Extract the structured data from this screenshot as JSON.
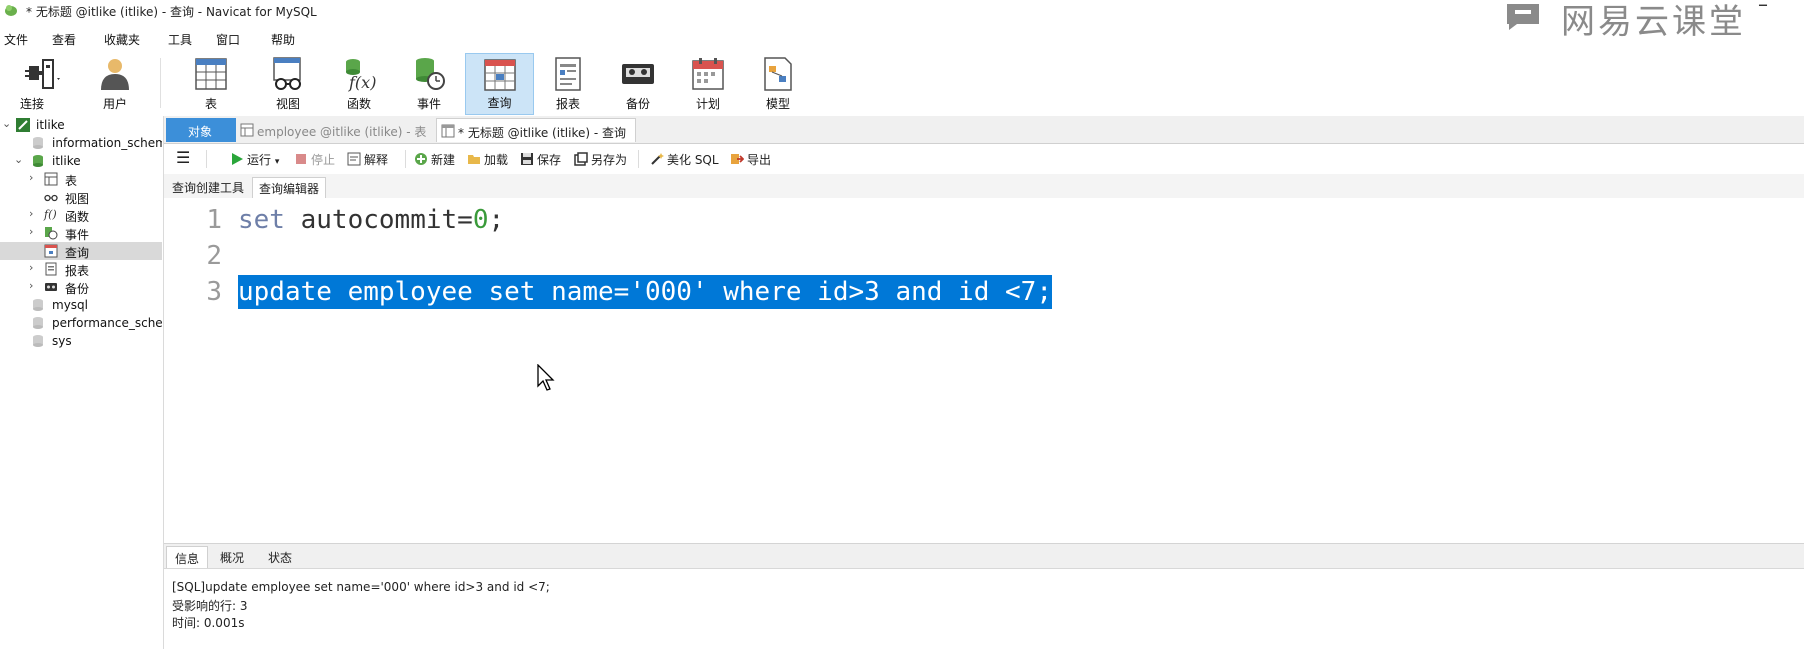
{
  "window": {
    "title": "* 无标题 @itlike (itlike) - 查询 - Navicat for MySQL",
    "watermark": "网易云课堂",
    "minimize_glyph": "–"
  },
  "menu": [
    "文件",
    "查看",
    "收藏夹",
    "工具",
    "窗口",
    "帮助"
  ],
  "ribbon": {
    "connect": "连接",
    "user": "用户",
    "table": "表",
    "view": "视图",
    "function": "函数",
    "event": "事件",
    "query": "查询",
    "report": "报表",
    "backup": "备份",
    "schedule": "计划",
    "model": "模型"
  },
  "sidebar": {
    "connection": "itlike",
    "items": [
      {
        "label": "information_schema"
      },
      {
        "label": "itlike"
      },
      {
        "label": "表"
      },
      {
        "label": "视图"
      },
      {
        "label": "函数"
      },
      {
        "label": "事件"
      },
      {
        "label": "查询"
      },
      {
        "label": "报表"
      },
      {
        "label": "备份"
      },
      {
        "label": "mysql"
      },
      {
        "label": "performance_schema"
      },
      {
        "label": "sys"
      }
    ]
  },
  "tabs": {
    "objects": "对象",
    "employee": "employee @itlike (itlike) - 表",
    "query": "* 无标题 @itlike (itlike) - 查询"
  },
  "toolbar": {
    "run": "运行",
    "stop": "停止",
    "explain": "解释",
    "new": "新建",
    "load": "加载",
    "save": "保存",
    "save_as": "另存为",
    "beautify": "美化 SQL",
    "export": "导出"
  },
  "subtabs": {
    "builder": "查询创建工具",
    "editor": "查询编辑器"
  },
  "editor": {
    "line_numbers": [
      "1",
      "2",
      "3"
    ],
    "line1_kw": "set",
    "line1_rest": " autocommit=",
    "line1_num": "0",
    "line1_end": ";",
    "line3": "update employee set name='000' where id>3 and id <7;"
  },
  "results": {
    "tabs": [
      "信息",
      "概况",
      "状态"
    ],
    "lines": [
      "[SQL]update employee set name='000' where id>3 and id <7;",
      "受影响的行: 3",
      "时间: 0.001s"
    ]
  },
  "colors": {
    "accent": "#3c8fd9",
    "selection": "#0078d7",
    "ribbon_active": "#cce4f7"
  }
}
